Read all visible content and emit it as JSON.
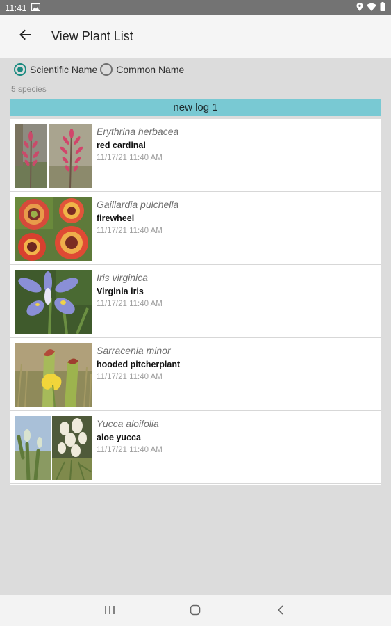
{
  "status_bar": {
    "time": "11:41",
    "left_icons": [
      "image-icon"
    ],
    "right_icons": [
      "location-icon",
      "wifi-icon",
      "battery-icon"
    ]
  },
  "app_bar": {
    "title": "View Plant List",
    "back_icon": "back-arrow-icon"
  },
  "name_toggle": {
    "options": [
      {
        "label": "Scientific Name",
        "selected": true
      },
      {
        "label": "Common Name",
        "selected": false
      }
    ]
  },
  "species_count": "5 species",
  "log": {
    "name": "new log 1",
    "header_color": "#79c9d3"
  },
  "plants": [
    {
      "scientific": "Erythrina herbacea",
      "common": "red cardinal",
      "time": "11/17/21 11:40 AM"
    },
    {
      "scientific": "Gaillardia pulchella",
      "common": "firewheel",
      "time": "11/17/21 11:40 AM"
    },
    {
      "scientific": "Iris virginica",
      "common": "Virginia iris",
      "time": "11/17/21 11:40 AM"
    },
    {
      "scientific": "Sarracenia minor",
      "common": "hooded pitcherplant",
      "time": "11/17/21 11:40 AM"
    },
    {
      "scientific": "Yucca aloifolia",
      "common": "aloe yucca",
      "time": "11/17/21 11:40 AM"
    }
  ],
  "nav_bar": {
    "icons": [
      "recent-apps-icon",
      "home-icon",
      "back-icon"
    ]
  },
  "colors": {
    "accent": "#1a8a80",
    "status_bar": "#737373",
    "background": "#dcdcdc"
  }
}
